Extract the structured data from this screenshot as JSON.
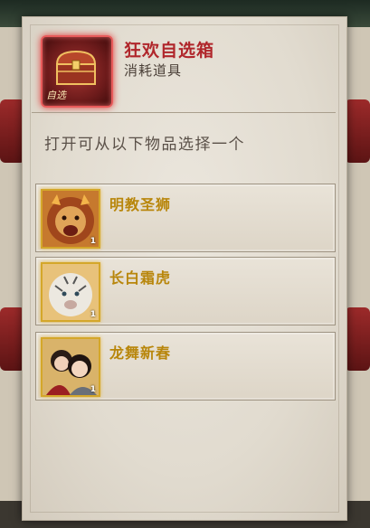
{
  "item": {
    "name": "狂欢自选箱",
    "type": "消耗道具",
    "icon": "treasure-chest-icon",
    "badge": "自选"
  },
  "instruction": "打开可从以下物品选择一个",
  "options": [
    {
      "name": "明教圣狮",
      "count": "1",
      "icon": "lion-portrait-icon"
    },
    {
      "name": "长白霜虎",
      "count": "1",
      "icon": "white-tiger-portrait-icon"
    },
    {
      "name": "龙舞新春",
      "count": "1",
      "icon": "two-characters-portrait-icon"
    }
  ],
  "colors": {
    "title": "#b0262b",
    "option_name": "#b8860b",
    "thumb_border": "#d4a72a"
  }
}
